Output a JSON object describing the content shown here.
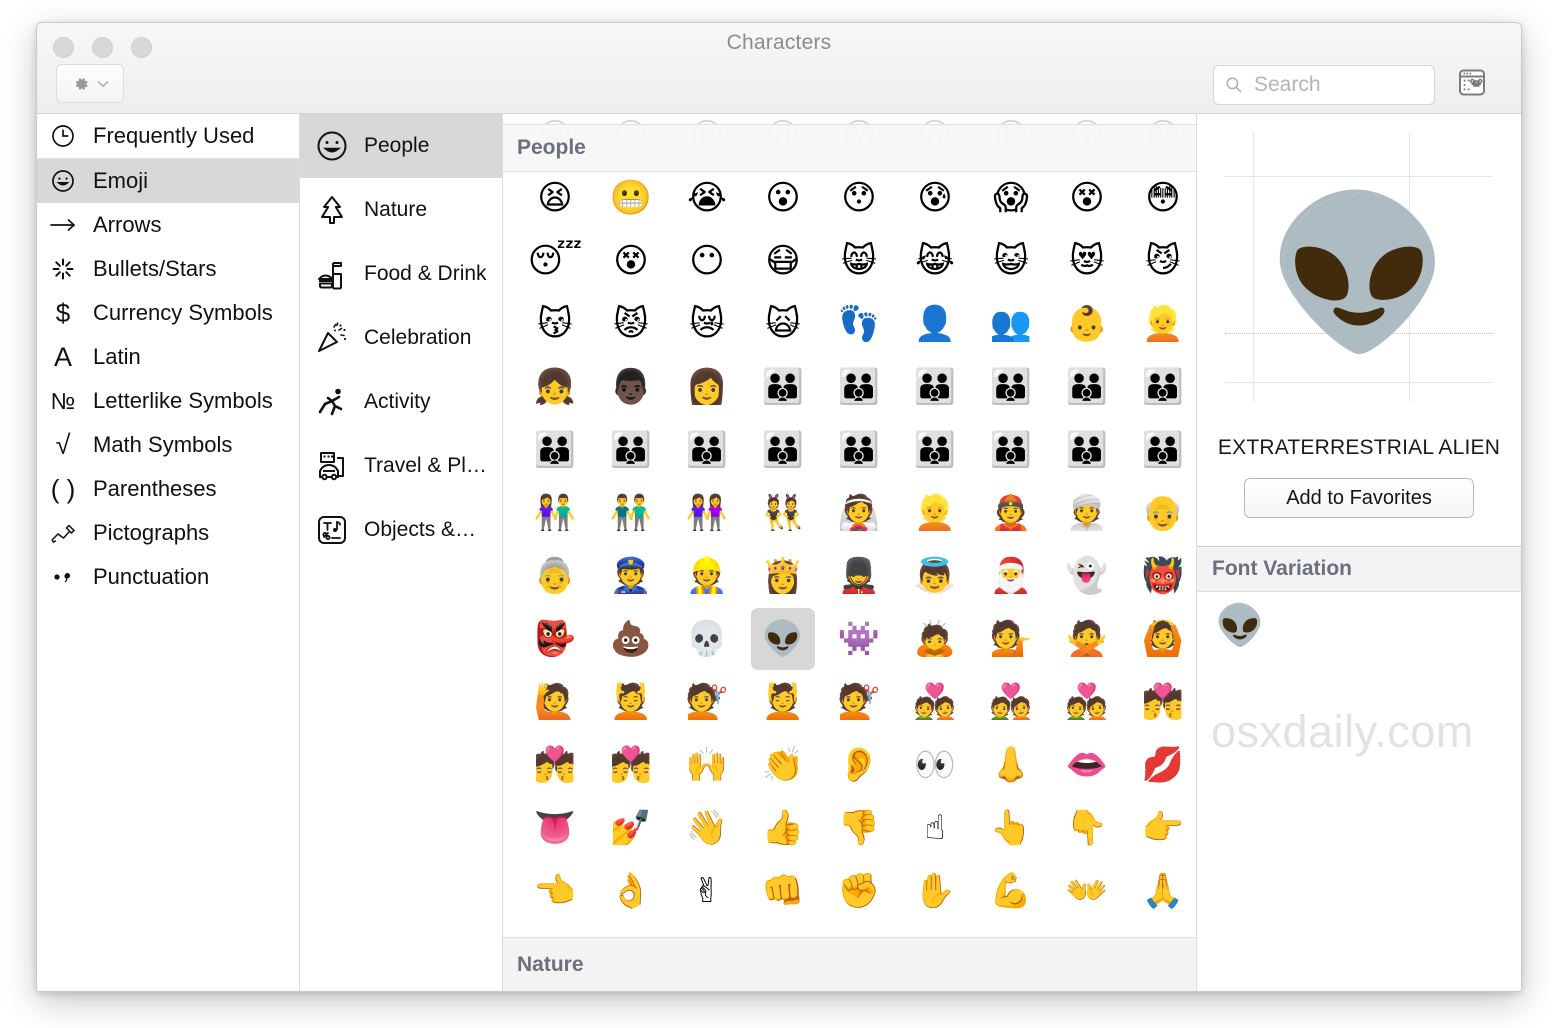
{
  "window": {
    "title": "Characters",
    "traffic_lights": [
      "close-button",
      "minimize-button",
      "zoom-button"
    ],
    "gear_button_label": "⚙",
    "chevron_label": "⌄"
  },
  "search": {
    "placeholder": "Search",
    "value": "",
    "icon": "search-icon"
  },
  "toolbar": {
    "keyboard_viewer_icon": "keyboard-viewer-icon"
  },
  "sidebar": {
    "items": [
      {
        "label": "Frequently Used",
        "icon": "clock-icon",
        "glyph": "🕐",
        "selected": false
      },
      {
        "label": "Emoji",
        "icon": "smiley-icon",
        "glyph": "☺",
        "selected": true
      },
      {
        "label": "Arrows",
        "icon": "arrow-right-icon",
        "glyph": "⟶",
        "selected": false
      },
      {
        "label": "Bullets/Stars",
        "icon": "starburst-icon",
        "glyph": "✳",
        "selected": false
      },
      {
        "label": "Currency Symbols",
        "icon": "dollar-icon",
        "glyph": "$",
        "selected": false
      },
      {
        "label": "Latin",
        "icon": "letter-a-icon",
        "glyph": "A",
        "selected": false
      },
      {
        "label": "Letterlike Symbols",
        "icon": "numero-icon",
        "glyph": "№",
        "selected": false
      },
      {
        "label": "Math Symbols",
        "icon": "square-root-icon",
        "glyph": "√",
        "selected": false
      },
      {
        "label": "Parentheses",
        "icon": "parentheses-icon",
        "glyph": "( )",
        "selected": false
      },
      {
        "label": "Pictographs",
        "icon": "pictograph-hand-icon",
        "glyph": "✍",
        "selected": false
      },
      {
        "label": "Punctuation",
        "icon": "punctuation-icon",
        "glyph": "•,",
        "selected": false
      }
    ]
  },
  "categories": {
    "items": [
      {
        "label": "People",
        "icon": "smiley-face-icon",
        "selected": true
      },
      {
        "label": "Nature",
        "icon": "tree-icon",
        "selected": false
      },
      {
        "label": "Food & Drink",
        "icon": "burger-drink-icon",
        "selected": false
      },
      {
        "label": "Celebration",
        "icon": "party-popper-icon",
        "selected": false
      },
      {
        "label": "Activity",
        "icon": "running-person-icon",
        "selected": false
      },
      {
        "label": "Travel & Pl…",
        "icon": "car-building-icon",
        "selected": false
      },
      {
        "label": "Objects &…",
        "icon": "symbols-icon",
        "selected": false
      }
    ]
  },
  "grid": {
    "section_header": "People",
    "bottom_header": "Nature",
    "partial_top_row": [
      "😖",
      "😣",
      "😫",
      "😩",
      "😯",
      "😦",
      "😧",
      "😮",
      "😓"
    ],
    "selected_emoji": "👽",
    "rows": [
      [
        "😫",
        "😬",
        "😭",
        "😮",
        "😯",
        "😰",
        "😱",
        "😵",
        "😳"
      ],
      [
        "😴",
        "😵",
        "😶",
        "😷",
        "😸",
        "😹",
        "😺",
        "😻",
        "😼"
      ],
      [
        "😽",
        "😾",
        "😿",
        "🙀",
        "👣",
        "👤",
        "👥",
        "👶",
        "👱"
      ],
      [
        "👧",
        "👨🏿",
        "👩",
        "👪",
        "👪",
        "👪",
        "👪",
        "👪",
        "👪"
      ],
      [
        "👪",
        "👪",
        "👪",
        "👪",
        "👪",
        "👪",
        "👪",
        "👪",
        "👪"
      ],
      [
        "👫",
        "👬",
        "👭",
        "👯",
        "👰",
        "👱",
        "👲",
        "👳",
        "👴"
      ],
      [
        "👵",
        "👮",
        "👷",
        "👸",
        "💂",
        "👼",
        "🎅",
        "👻",
        "👹"
      ],
      [
        "👺",
        "💩",
        "💀",
        "👽",
        "👾",
        "🙇",
        "💁",
        "🙅",
        "🙆"
      ],
      [
        "🙋",
        "💆",
        "💇",
        "💆",
        "💇",
        "💑",
        "💑",
        "💑",
        "💏"
      ],
      [
        "💏",
        "💏",
        "🙌",
        "👏",
        "👂",
        "👀",
        "👃",
        "👄",
        "💋"
      ],
      [
        "👅",
        "💅",
        "👋",
        "👍",
        "👎",
        "☝",
        "👆",
        "👇",
        "👉"
      ],
      [
        "👈",
        "👌",
        "✌",
        "👊",
        "✊",
        "✋",
        "💪",
        "👐",
        "🙏"
      ]
    ]
  },
  "detail": {
    "emoji": "👽",
    "character_name": "EXTRATERRESTRIAL ALIEN",
    "favorites_button": "Add to Favorites",
    "font_variation_header": "Font Variation",
    "font_variation_items": [
      "👽"
    ],
    "watermark": "osxdaily.com"
  },
  "colors": {
    "selection": "#d8d8d8",
    "header_text": "#6b6f80",
    "window_chrome": "#f3f3f3",
    "guide_blue": "#dfe8f2"
  }
}
